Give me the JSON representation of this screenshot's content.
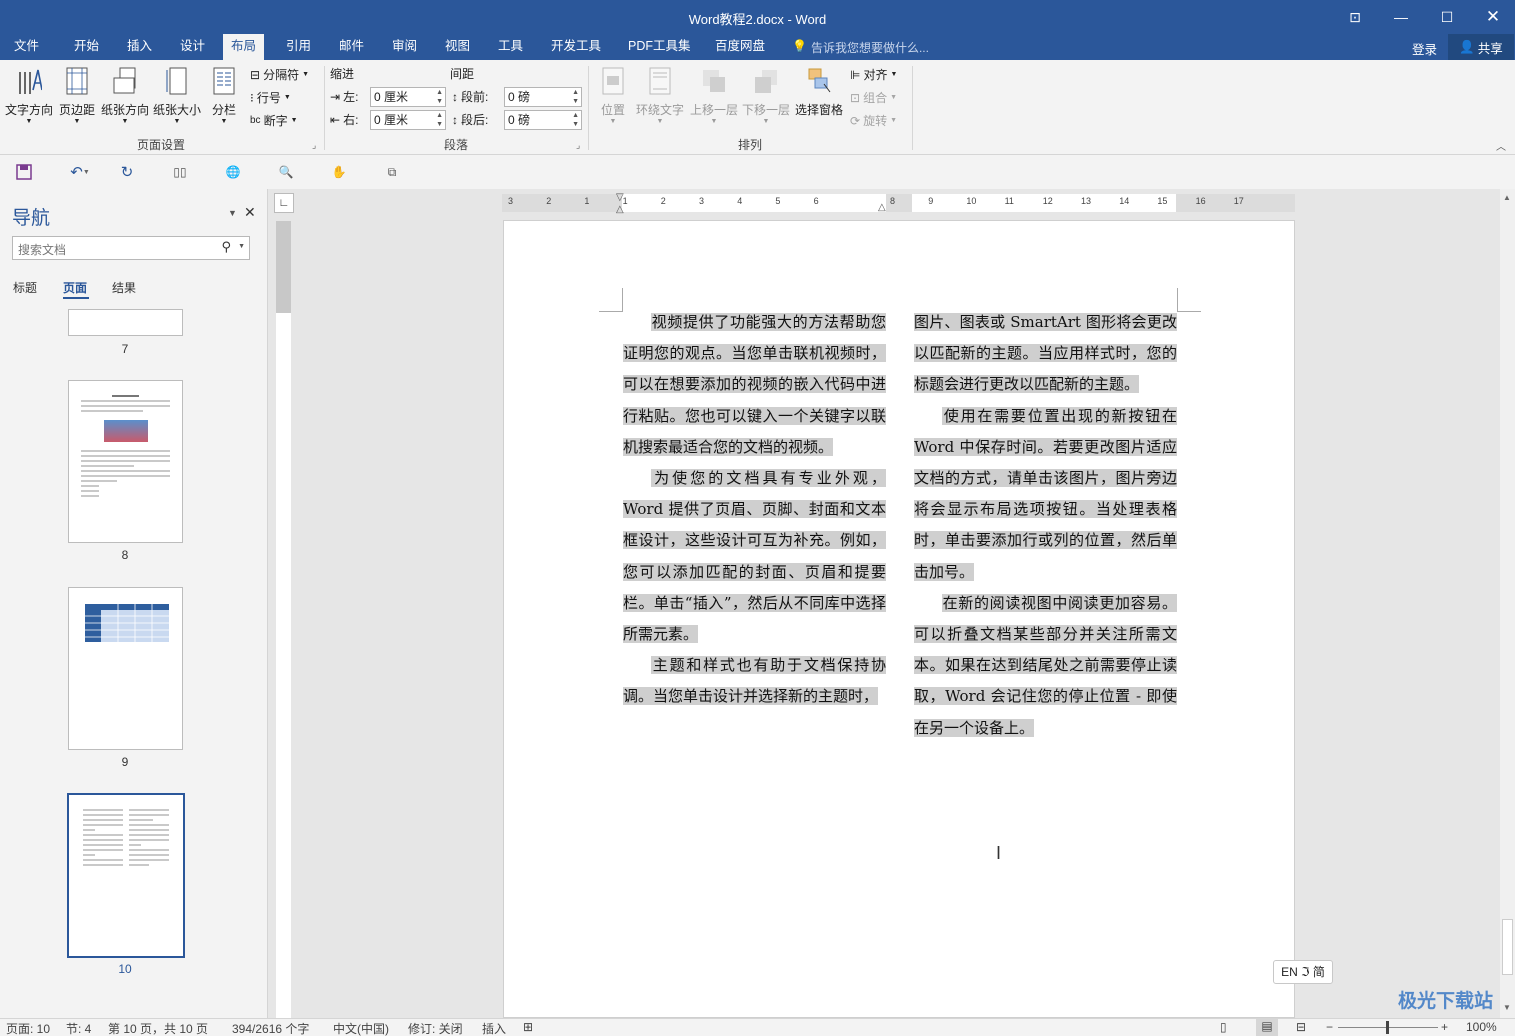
{
  "titlebar": {
    "title": "Word教程2.docx - Word"
  },
  "tabs": [
    "文件",
    "开始",
    "插入",
    "设计",
    "布局",
    "引用",
    "邮件",
    "审阅",
    "视图",
    "工具",
    "开发工具",
    "PDF工具集",
    "百度网盘"
  ],
  "tell_me": "告诉我您想要做什么...",
  "login": "登录",
  "share": "共享",
  "ribbon": {
    "page_setup": {
      "text_direction": "文字方向",
      "margins": "页边距",
      "orientation": "纸张方向",
      "size": "纸张大小",
      "columns": "分栏",
      "breaks": "分隔符",
      "line_numbers": "行号",
      "hyphenation": "断字",
      "group": "页面设置"
    },
    "paragraph": {
      "indent": "缩进",
      "spacing": "间距",
      "left_label": "左:",
      "left_value": "0 厘米",
      "right_label": "右:",
      "right_value": "0 厘米",
      "before_label": "段前:",
      "before_value": "0 磅",
      "after_label": "段后:",
      "after_value": "0 磅",
      "group": "段落"
    },
    "arrange": {
      "position": "位置",
      "wrap": "环绕文字",
      "forward": "上移一层",
      "backward": "下移一层",
      "selection_pane": "选择窗格",
      "align": "对齐",
      "group_btn": "组合",
      "rotate": "旋转",
      "group": "排列"
    }
  },
  "nav": {
    "title": "导航",
    "search_placeholder": "搜索文档",
    "tabs": [
      "标题",
      "页面",
      "结果"
    ],
    "page_numbers": [
      "7",
      "8",
      "9",
      "10"
    ]
  },
  "document": {
    "col1": [
      "视频提供了功能强大的方法帮助您证明您的观点。当您单击联机视频时，可以在想要添加的视频的嵌入代码中进行粘贴。您也可以键入一个关键字以联机搜索最适合您的文档的视频。",
      "为使您的文档具有专业外观，Word 提供了页眉、页脚、封面和文本框设计，这些设计可互为补充。例如，您可以添加匹配的封面、页眉和提要栏。单击“插入”，然后从不同库中选择所需元素。",
      "主题和样式也有助于文档保持协调。当您单击设计并选择新的主题时，"
    ],
    "col2": [
      "图片、图表或 SmartArt 图形将会更改以匹配新的主题。当应用样式时，您的标题会进行更改以匹配新的主题。",
      "使用在需要位置出现的新按钮在 Word 中保存时间。若要更改图片适应文档的方式，请单击该图片，图片旁边将会显示布局选项按钮。当处理表格时，单击要添加行或列的位置，然后单击加号。",
      "在新的阅读视图中阅读更加容易。可以折叠文档某些部分并关注所需文本。如果在达到结尾处之前需要停止读取，Word 会记住您的停止位置 - 即使在另一个设备上。"
    ]
  },
  "ruler_numbers": [
    "3",
    "2",
    "1",
    "1",
    "2",
    "3",
    "4",
    "5",
    "6",
    "8",
    "9",
    "10",
    "11",
    "12",
    "13",
    "14",
    "15",
    "16",
    "17"
  ],
  "ime": "EN ℑ 简",
  "status": {
    "page": "页面: 10",
    "section": "节: 4",
    "page_of": "第 10 页，共 10 页",
    "words": "394/2616 个字",
    "lang": "中文(中国)",
    "track": "修订: 关闭",
    "mode": "插入",
    "zoom": "100%"
  },
  "watermark": "极光下载站"
}
